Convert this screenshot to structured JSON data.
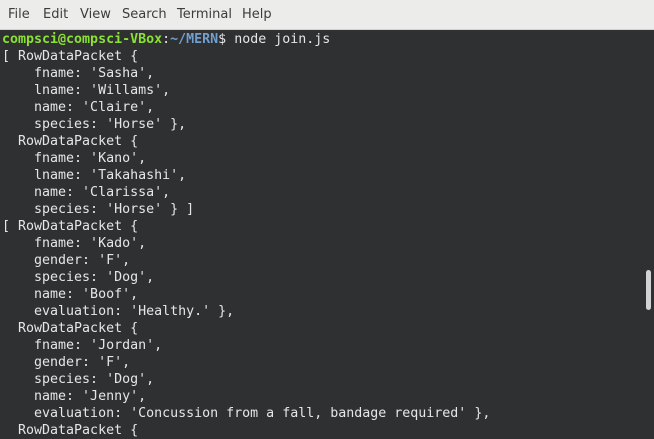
{
  "menubar": {
    "items": [
      "File",
      "Edit",
      "View",
      "Search",
      "Terminal",
      "Help"
    ]
  },
  "prompt": {
    "user_host": "compsci@compsci-VBox",
    "colon": ":",
    "path": "~/MERN",
    "sign": "$",
    "command": " node join.js"
  },
  "output_lines": [
    "[ RowDataPacket {",
    "    fname: 'Sasha',",
    "    lname: 'Willams',",
    "    name: 'Claire',",
    "    species: 'Horse' },",
    "  RowDataPacket {",
    "    fname: 'Kano',",
    "    lname: 'Takahashi',",
    "    name: 'Clarissa',",
    "    species: 'Horse' } ]",
    "[ RowDataPacket {",
    "    fname: 'Kado',",
    "    gender: 'F',",
    "    species: 'Dog',",
    "    name: 'Boof',",
    "    evaluation: 'Healthy.' },",
    "  RowDataPacket {",
    "    fname: 'Jordan',",
    "    gender: 'F',",
    "    species: 'Dog',",
    "    name: 'Jenny',",
    "    evaluation: 'Concussion from a fall, bandage required' },",
    "  RowDataPacket {"
  ],
  "colors": {
    "terminal_bg": "#2f3031",
    "terminal_fg": "#e6e6e6",
    "prompt_user": "#8ae234",
    "prompt_path": "#729fcf",
    "menubar_bg": "#ececeb"
  }
}
